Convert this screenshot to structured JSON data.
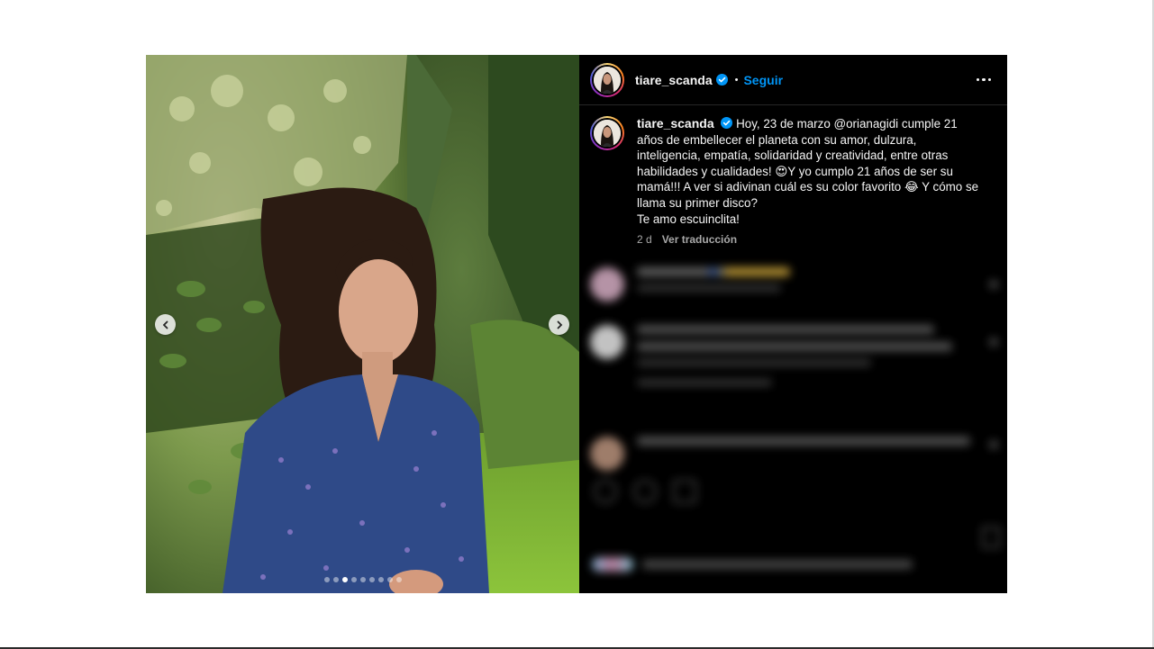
{
  "post": {
    "header": {
      "username": "tiare_scanda",
      "separator": "•",
      "follow_label": "Seguir"
    },
    "caption": {
      "username": "tiare_scanda",
      "text": "Hoy, 23 de marzo @orianagidi cumple 21 años de embellecer el planeta con su amor, dulzura, inteligencia, empatía, solidaridad y creatividad, entre otras habilidades y cualidades! 😍Y yo cumplo 21 años de ser su mamá!!! A ver si adivinan cuál es su color favorito 😂 Y cómo se llama su primer disco?\nTe amo escuinclita!",
      "time": "2 d",
      "translate_label": "Ver traducción"
    },
    "carousel": {
      "total_slides": 9,
      "active_index": 2
    }
  },
  "colors": {
    "panel_bg": "#000000",
    "follow_blue": "#0095f6",
    "verified_blue": "#0095f6",
    "meta_gray": "#a8a8a8"
  },
  "icons": [
    "chevron-left-icon",
    "chevron-right-icon",
    "verified-badge-icon",
    "more-options-icon"
  ]
}
